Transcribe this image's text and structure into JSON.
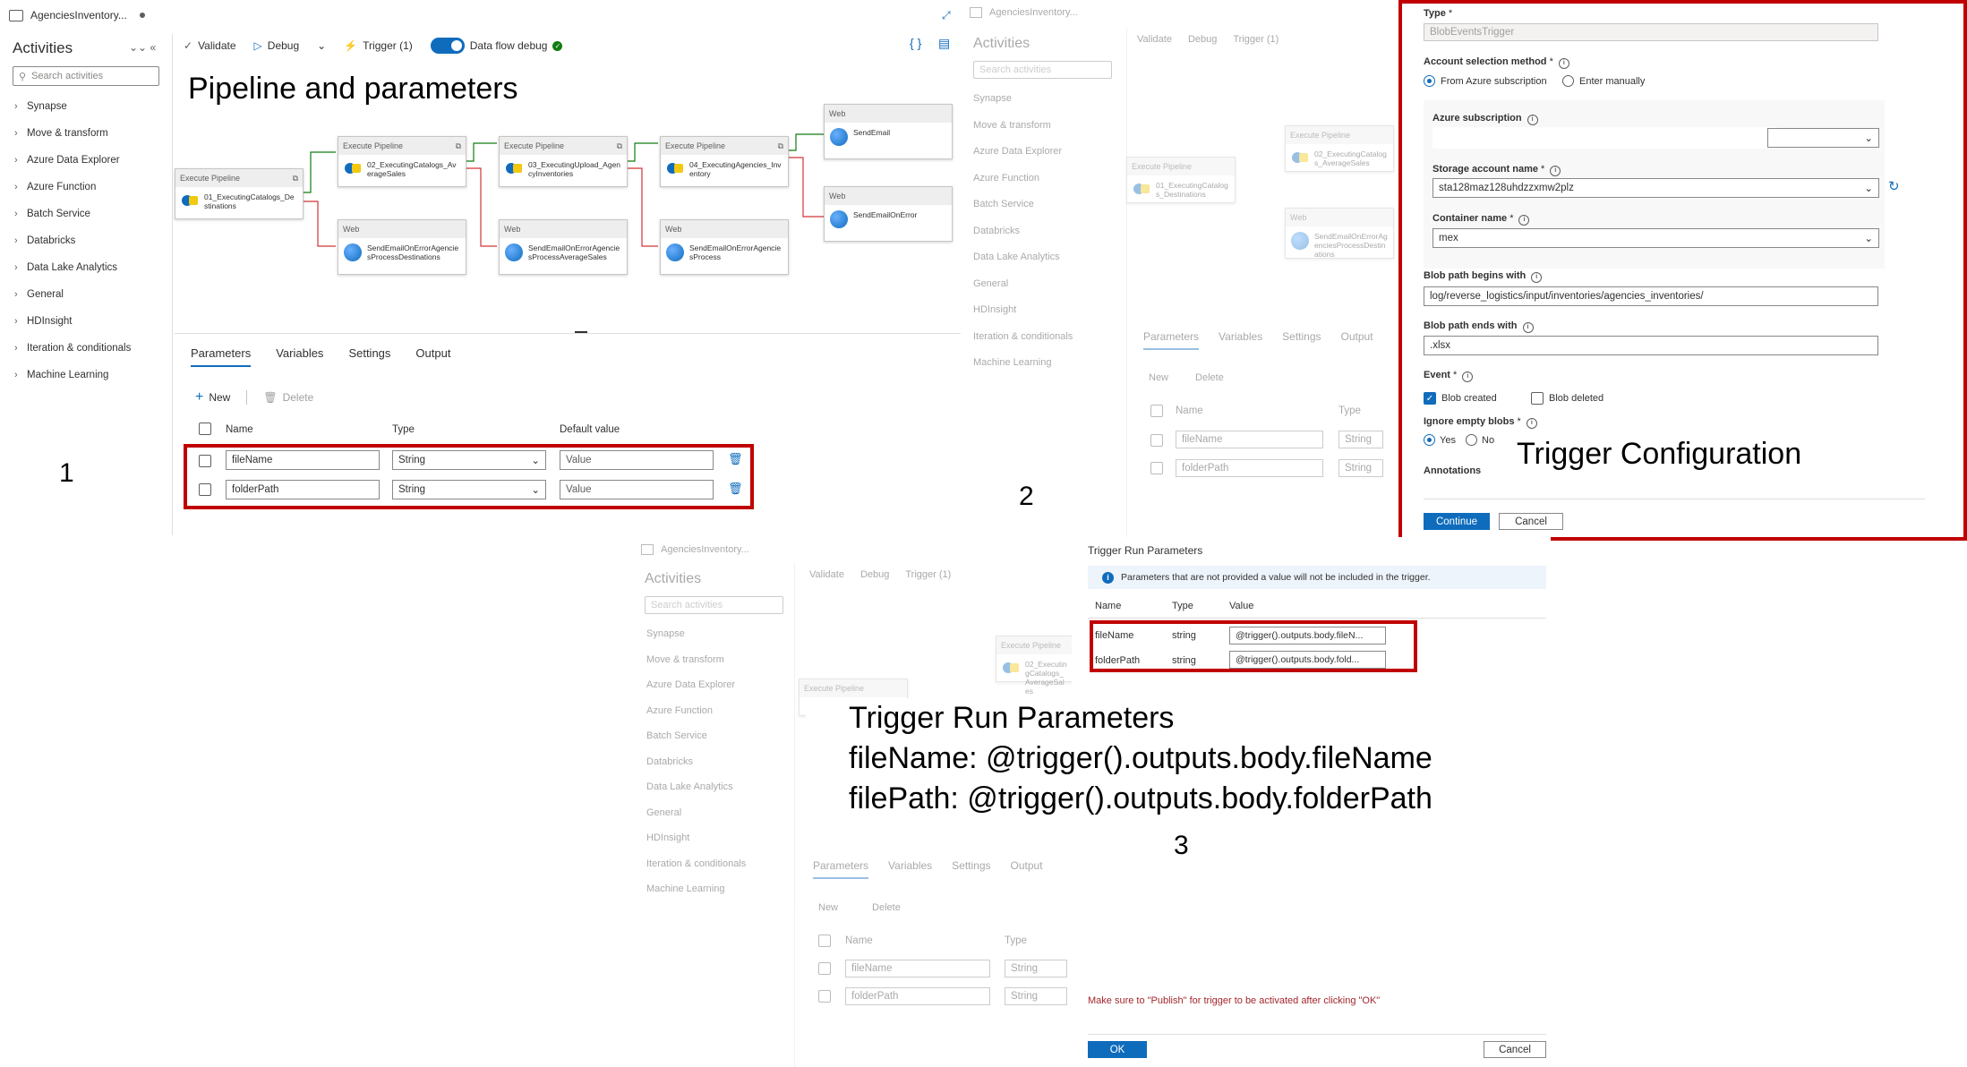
{
  "window": {
    "tab_title": "AgenciesInventory..."
  },
  "activities": {
    "title": "Activities",
    "search_placeholder": "Search activities",
    "items": [
      "Synapse",
      "Move & transform",
      "Azure Data Explorer",
      "Azure Function",
      "Batch Service",
      "Databricks",
      "Data Lake Analytics",
      "General",
      "HDInsight",
      "Iteration & conditionals",
      "Machine Learning"
    ]
  },
  "toolbar": {
    "validate": "Validate",
    "debug": "Debug",
    "trigger": "Trigger (1)",
    "dataflow_debug": "Data flow debug"
  },
  "panel1": {
    "heading": "Pipeline and parameters",
    "number": "1",
    "canvas": {
      "hdr_exec": "Execute Pipeline",
      "hdr_web": "Web",
      "a1": "01_ExecutingCatalogs_Destinations",
      "a2": "02_ExecutingCatalogs_AverageSales",
      "a3": "03_ExecutingUpload_AgencyInventories",
      "a4": "04_ExecutingAgencies_Inventory",
      "w1": "SendEmailOnErrorAgenciesProcessDestinations",
      "w2": "SendEmailOnErrorAgenciesProcessAverageSales",
      "w3": "SendEmailOnErrorAgenciesProcess",
      "w4": "SendEmail",
      "w5": "SendEmailOnError"
    },
    "tabs": [
      "Parameters",
      "Variables",
      "Settings",
      "Output"
    ],
    "new": "New",
    "delete": "Delete",
    "columns": {
      "name": "Name",
      "type": "Type",
      "default": "Default value"
    },
    "rows": [
      {
        "name": "fileName",
        "type": "String",
        "default": "Value"
      },
      {
        "name": "folderPath",
        "type": "String",
        "default": "Value"
      }
    ]
  },
  "panel2": {
    "number": "2",
    "caption": "Trigger Configuration",
    "type_label": "Type",
    "type_value": "BlobEventsTrigger",
    "account_method_label": "Account selection method",
    "opt_subscription": "From Azure subscription",
    "opt_manual": "Enter manually",
    "subscription_label": "Azure subscription",
    "storage_label": "Storage account name",
    "storage_value": "sta128maz128uhdzzxmw2plz",
    "container_label": "Container name",
    "container_value": "mex",
    "begins_label": "Blob path begins with",
    "begins_value": "log/reverse_logistics/input/inventories/agencies_inventories/",
    "ends_label": "Blob path ends with",
    "ends_value": ".xlsx",
    "event_label": "Event",
    "blob_created": "Blob created",
    "blob_deleted": "Blob deleted",
    "ignore_label": "Ignore empty blobs",
    "yes": "Yes",
    "no": "No",
    "annotations": "Annotations",
    "continue": "Continue",
    "cancel": "Cancel",
    "bg_rows": [
      "fileName",
      "folderPath"
    ],
    "bg_type": "String",
    "bg_canvas": {
      "a1": "01_ExecutingCatalogs_Destinations",
      "a2": "02_ExecutingCatalogs_AverageSales",
      "w1": "SendEmailOnErrorAgenciesProcessDestinations"
    }
  },
  "panel3": {
    "number": "3",
    "title": "Trigger Run Parameters",
    "info": "Parameters that are not provided a value will not be included in the trigger.",
    "columns": {
      "name": "Name",
      "type": "Type",
      "value": "Value"
    },
    "rows": [
      {
        "name": "fileName",
        "type": "string",
        "value": "@trigger().outputs.body.fileN..."
      },
      {
        "name": "folderPath",
        "type": "string",
        "value": "@trigger().outputs.body.fold..."
      }
    ],
    "caption_lines": [
      "Trigger Run Parameters",
      "fileName: @trigger().outputs.body.fileName",
      "filePath: @trigger().outputs.body.folderPath"
    ],
    "publish_note": "Make sure to \"Publish\" for trigger to be activated after clicking \"OK\"",
    "ok": "OK",
    "cancel": "Cancel",
    "bg_rows": [
      "fileName",
      "folderPath"
    ],
    "bg_type": "String",
    "bg_canvas": {
      "a2": "02_ExecutingCatalogs_AverageSales"
    }
  },
  "colors": {
    "accent": "#0f6cbd",
    "highlight_box": "#c00000",
    "success": "#107c10",
    "error_text": "#a4262c"
  }
}
